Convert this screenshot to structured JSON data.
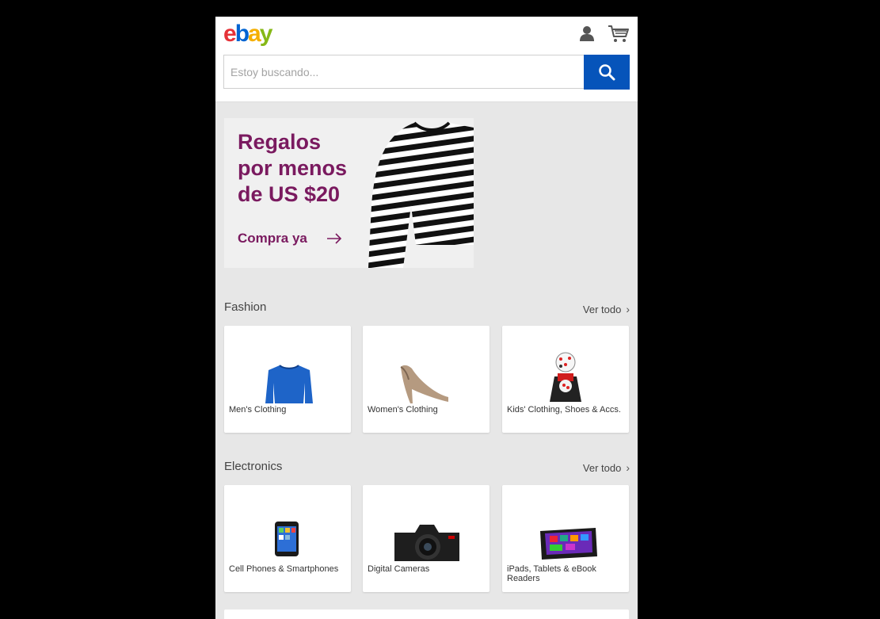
{
  "header": {
    "logo_letters": [
      "e",
      "b",
      "a",
      "y"
    ],
    "icons": [
      "user-icon",
      "cart-icon"
    ]
  },
  "search": {
    "placeholder": "Estoy buscando...",
    "value": "",
    "button_icon": "search-icon",
    "button_color": "#0654ba"
  },
  "banner": {
    "headline": "Regalos\npor menos\nde US $20",
    "cta": "Compra ya",
    "color": "#7a1a5f"
  },
  "fashion": {
    "title": "Fashion",
    "see_all": "Ver todo",
    "items": [
      {
        "label": "Men's Clothing",
        "icon": "sweater-icon"
      },
      {
        "label": "Women's Clothing",
        "icon": "high-heel-icon"
      },
      {
        "label": "Kids' Clothing, Shoes & Accs.",
        "icon": "kids-outfit-icon"
      }
    ]
  },
  "electronics": {
    "title": "Electronics",
    "see_all": "Ver todo",
    "items": [
      {
        "label": "Cell Phones & Smartphones",
        "icon": "smartphone-icon"
      },
      {
        "label": "Digital Cameras",
        "icon": "camera-icon"
      },
      {
        "label": "iPads, Tablets & eBook Readers",
        "icon": "tablet-icon"
      }
    ]
  }
}
